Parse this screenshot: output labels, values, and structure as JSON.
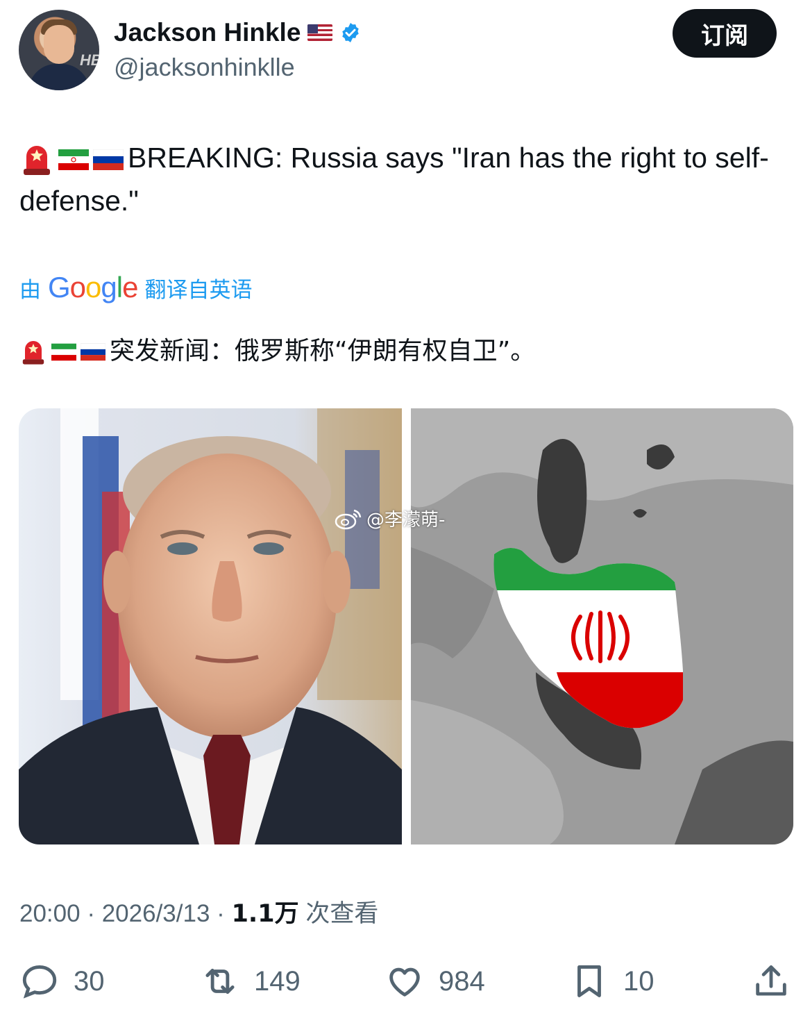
{
  "author": {
    "name": "Jackson Hinkle",
    "handle": "@jacksonhinklle",
    "avatar_watermark": "HB",
    "flag_icon": "us-flag-icon",
    "verified_icon": "verified-badge-icon",
    "verified_color": "#1d9bf0"
  },
  "subscribe_label": "订阅",
  "tweet": {
    "text": "BREAKING: Russia says \"Iran has the right to self-defense.\"",
    "emojis": [
      "police-light-icon",
      "iran-flag-icon",
      "russia-flag-icon"
    ]
  },
  "translation": {
    "prefix": "由",
    "provider": "Google",
    "suffix": "翻译自英语",
    "text": "突发新闻：俄罗斯称“伊朗有权自卫”。"
  },
  "media": {
    "left_image": "portrait-photo",
    "right_image": "iran-flag-map-image",
    "watermark": "@李濛萌-"
  },
  "meta": {
    "time": "20:00",
    "separator": "·",
    "date": "2026/3/13",
    "views": "1.1万",
    "views_label": "次查看"
  },
  "actions": {
    "replies": "30",
    "reposts": "149",
    "likes": "984",
    "bookmarks": "10"
  },
  "colors": {
    "text": "#0f1419",
    "secondary": "#536471",
    "accent": "#1d9bf0",
    "button_bg": "#0f1419"
  }
}
